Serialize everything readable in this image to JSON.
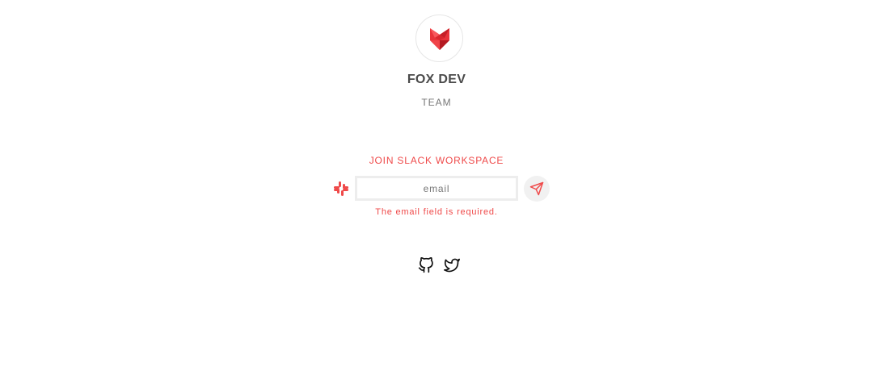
{
  "brand": {
    "name": "FOX DEV",
    "subtitle": "TEAM",
    "logo_icon": "fox-logo-icon"
  },
  "join": {
    "title": "JOIN SLACK WORKSPACE",
    "slack_icon": "slack-icon",
    "email_placeholder": "email",
    "email_value": "",
    "send_icon": "paper-plane-icon",
    "error": "The email field is required."
  },
  "social": {
    "items": [
      {
        "icon": "github-icon"
      },
      {
        "icon": "twitter-icon"
      }
    ]
  },
  "colors": {
    "accent": "#ef4a4a",
    "text_dark": "#4a4a4a",
    "text_muted": "#777777",
    "input_border": "#ededed",
    "button_bg": "#f1f1f1"
  }
}
